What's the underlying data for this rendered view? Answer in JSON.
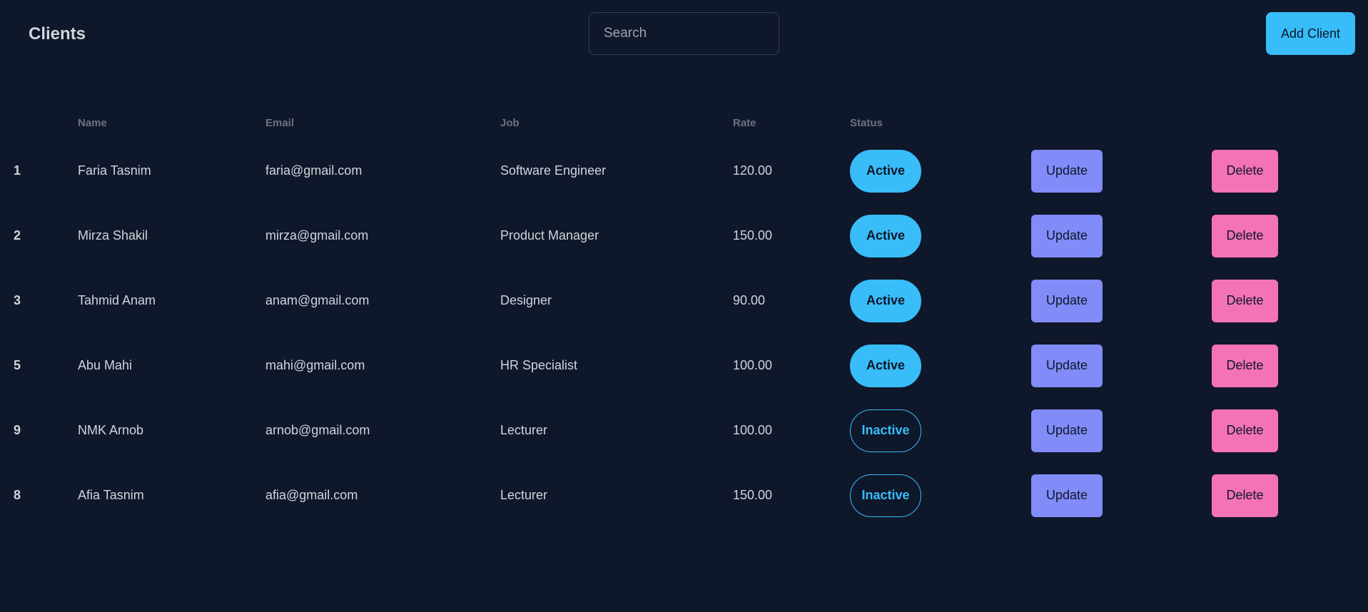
{
  "header": {
    "title": "Clients",
    "search_placeholder": "Search",
    "search_value": "",
    "add_button_label": "Add Client"
  },
  "table": {
    "columns": {
      "index": "",
      "name": "Name",
      "email": "Email",
      "job": "Job",
      "rate": "Rate",
      "status": "Status"
    },
    "rows": [
      {
        "id": "1",
        "name": "Faria Tasnim",
        "email": "faria@gmail.com",
        "job": "Software Engineer",
        "rate": "120.00",
        "status": "Active",
        "update": "Update",
        "delete": "Delete"
      },
      {
        "id": "2",
        "name": "Mirza Shakil",
        "email": "mirza@gmail.com",
        "job": "Product Manager",
        "rate": "150.00",
        "status": "Active",
        "update": "Update",
        "delete": "Delete"
      },
      {
        "id": "3",
        "name": "Tahmid Anam",
        "email": "anam@gmail.com",
        "job": "Designer",
        "rate": "90.00",
        "status": "Active",
        "update": "Update",
        "delete": "Delete"
      },
      {
        "id": "5",
        "name": "Abu Mahi",
        "email": "mahi@gmail.com",
        "job": "HR Specialist",
        "rate": "100.00",
        "status": "Active",
        "update": "Update",
        "delete": "Delete"
      },
      {
        "id": "9",
        "name": "NMK Arnob",
        "email": "arnob@gmail.com",
        "job": "Lecturer",
        "rate": "100.00",
        "status": "Inactive",
        "update": "Update",
        "delete": "Delete"
      },
      {
        "id": "8",
        "name": "Afia Tasnim",
        "email": "afia@gmail.com",
        "job": "Lecturer",
        "rate": "150.00",
        "status": "Inactive",
        "update": "Update",
        "delete": "Delete"
      }
    ]
  },
  "colors": {
    "background": "#0f172a",
    "accent": "#38bdf8",
    "update": "#818cf8",
    "delete": "#f472b6",
    "header_text": "#6b7280",
    "text": "#d1d5db"
  }
}
